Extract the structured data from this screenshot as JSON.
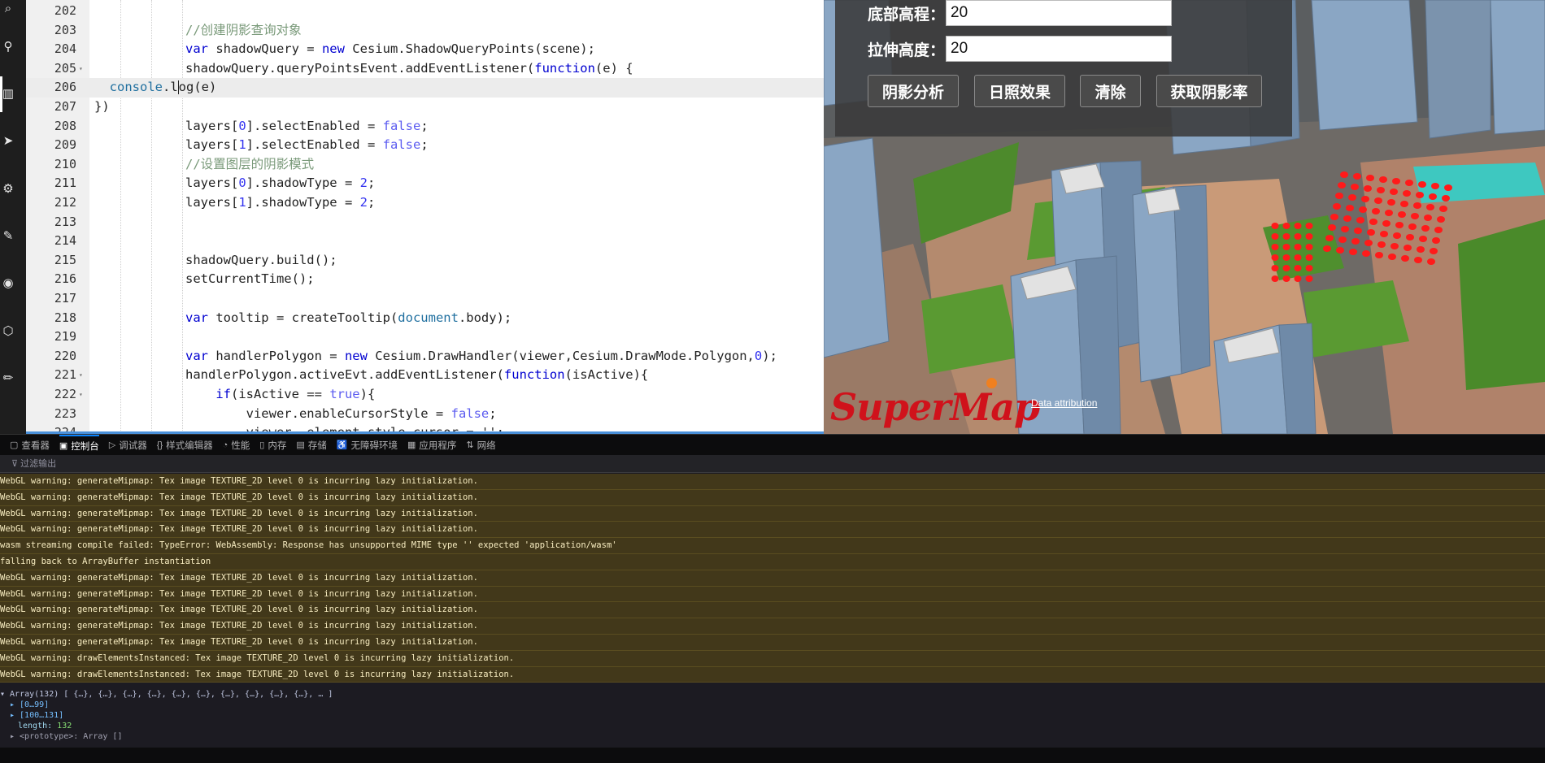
{
  "sidebar": {
    "icons": [
      "search-icon",
      "pin-icon",
      "map-icon",
      "send-icon",
      "bike-icon",
      "edit-icon",
      "eye-icon",
      "cube-icon",
      "pencil-icon"
    ]
  },
  "editor": {
    "lines": [
      {
        "n": "202",
        "fold": "",
        "html": ""
      },
      {
        "n": "203",
        "fold": "",
        "html": "<span class='cmt'>            //创建阴影查询对象</span>"
      },
      {
        "n": "204",
        "fold": "",
        "html": "            <span class='kw'>var</span> shadowQuery = <span class='kw'>new</span> Cesium.ShadowQueryPoints(scene);"
      },
      {
        "n": "205",
        "fold": "▾",
        "html": "            shadowQuery.queryPointsEvent.addEventListener(<span class='kw'>function</span>(e) {"
      },
      {
        "n": "206",
        "fold": "",
        "html": "  <span class='glob'>console</span>.l<span class='cursor'></span>og(e)"
      },
      {
        "n": "207",
        "fold": "",
        "html": "})"
      },
      {
        "n": "208",
        "fold": "",
        "html": "            layers[<span class='num'>0</span>].selectEnabled = <span class='bool'>false</span>;"
      },
      {
        "n": "209",
        "fold": "",
        "html": "            layers[<span class='num'>1</span>].selectEnabled = <span class='bool'>false</span>;"
      },
      {
        "n": "210",
        "fold": "",
        "html": "<span class='cmt'>            //设置图层的阴影模式</span>"
      },
      {
        "n": "211",
        "fold": "",
        "html": "            layers[<span class='num'>0</span>].shadowType = <span class='num'>2</span>;"
      },
      {
        "n": "212",
        "fold": "",
        "html": "            layers[<span class='num'>1</span>].shadowType = <span class='num'>2</span>;"
      },
      {
        "n": "213",
        "fold": "",
        "html": ""
      },
      {
        "n": "214",
        "fold": "",
        "html": ""
      },
      {
        "n": "215",
        "fold": "",
        "html": "            shadowQuery.build();"
      },
      {
        "n": "216",
        "fold": "",
        "html": "            setCurrentTime();"
      },
      {
        "n": "217",
        "fold": "",
        "html": ""
      },
      {
        "n": "218",
        "fold": "",
        "html": "            <span class='kw'>var</span> tooltip = createTooltip(<span class='glob'>document</span>.body);"
      },
      {
        "n": "219",
        "fold": "",
        "html": ""
      },
      {
        "n": "220",
        "fold": "",
        "html": "            <span class='kw'>var</span> handlerPolygon = <span class='kw'>new</span> Cesium.DrawHandler(viewer,Cesium.DrawMode.Polygon,<span class='num'>0</span>);"
      },
      {
        "n": "221",
        "fold": "▾",
        "html": "            handlerPolygon.activeEvt.addEventListener(<span class='kw'>function</span>(isActive){"
      },
      {
        "n": "222",
        "fold": "▾",
        "html": "                <span class='kw'>if</span>(isActive == <span class='bool'>true</span>){"
      },
      {
        "n": "223",
        "fold": "",
        "html": "                    viewer.enableCursorStyle = <span class='bool'>false</span>;"
      },
      {
        "n": "224",
        "fold": "",
        "html": "                    viewer._element.style.cursor = '';"
      }
    ]
  },
  "map": {
    "bottom_height_label": "底部高程：",
    "bottom_height_value": "20",
    "extrude_height_label": "拉伸高度：",
    "extrude_height_value": "20",
    "btn_shadow_analysis": "阴影分析",
    "btn_sunlight": "日照效果",
    "btn_clear": "清除",
    "btn_get_ratio": "获取阴影率",
    "logo": "SuperMap",
    "attribution": "Data attribution",
    "accent_color": "#ff0000"
  },
  "devtools": {
    "tabs": [
      {
        "icon": "▢",
        "label": "查看器",
        "name": "tab-inspector"
      },
      {
        "icon": "▣",
        "label": "控制台",
        "name": "tab-console",
        "active": true
      },
      {
        "icon": "▷",
        "label": "调试器",
        "name": "tab-debugger"
      },
      {
        "icon": "{}",
        "label": "样式编辑器",
        "name": "tab-style-editor"
      },
      {
        "icon": "◔",
        "label": "性能",
        "name": "tab-performance"
      },
      {
        "icon": "▯",
        "label": "内存",
        "name": "tab-memory"
      },
      {
        "icon": "▤",
        "label": "存储",
        "name": "tab-storage"
      },
      {
        "icon": "♿",
        "label": "无障碍环境",
        "name": "tab-accessibility"
      },
      {
        "icon": "▦",
        "label": "应用程序",
        "name": "tab-application"
      },
      {
        "icon": "⇅",
        "label": "网络",
        "name": "tab-network"
      }
    ],
    "filter_placeholder": "过滤输出",
    "logs": [
      "WebGL warning: generateMipmap: Tex image TEXTURE_2D level 0 is incurring lazy initialization.",
      "WebGL warning: generateMipmap: Tex image TEXTURE_2D level 0 is incurring lazy initialization.",
      "WebGL warning: generateMipmap: Tex image TEXTURE_2D level 0 is incurring lazy initialization.",
      "WebGL warning: generateMipmap: Tex image TEXTURE_2D level 0 is incurring lazy initialization.",
      "wasm streaming compile failed: TypeError: WebAssembly: Response has unsupported MIME type '' expected 'application/wasm'",
      "falling back to ArrayBuffer instantiation",
      "WebGL warning: generateMipmap: Tex image TEXTURE_2D level 0 is incurring lazy initialization.",
      "WebGL warning: generateMipmap: Tex image TEXTURE_2D level 0 is incurring lazy initialization.",
      "WebGL warning: generateMipmap: Tex image TEXTURE_2D level 0 is incurring lazy initialization.",
      "WebGL warning: generateMipmap: Tex image TEXTURE_2D level 0 is incurring lazy initialization.",
      "WebGL warning: generateMipmap: Tex image TEXTURE_2D level 0 is incurring lazy initialization.",
      "WebGL warning: drawElementsInstanced: Tex image TEXTURE_2D level 0 is incurring lazy initialization.",
      "WebGL warning: drawElementsInstanced: Tex image TEXTURE_2D level 0 is incurring lazy initialization."
    ],
    "array_head": "▾ Array(132) [ {…}, {…}, {…}, {…}, {…}, {…}, {…}, {…}, {…}, {…}, … ]",
    "array_range1": "▸ [0…99]",
    "array_range2": "▸ [100…131]",
    "array_length_key": "length: ",
    "array_length_value": "132",
    "array_proto": "▸ <prototype>: Array []"
  }
}
